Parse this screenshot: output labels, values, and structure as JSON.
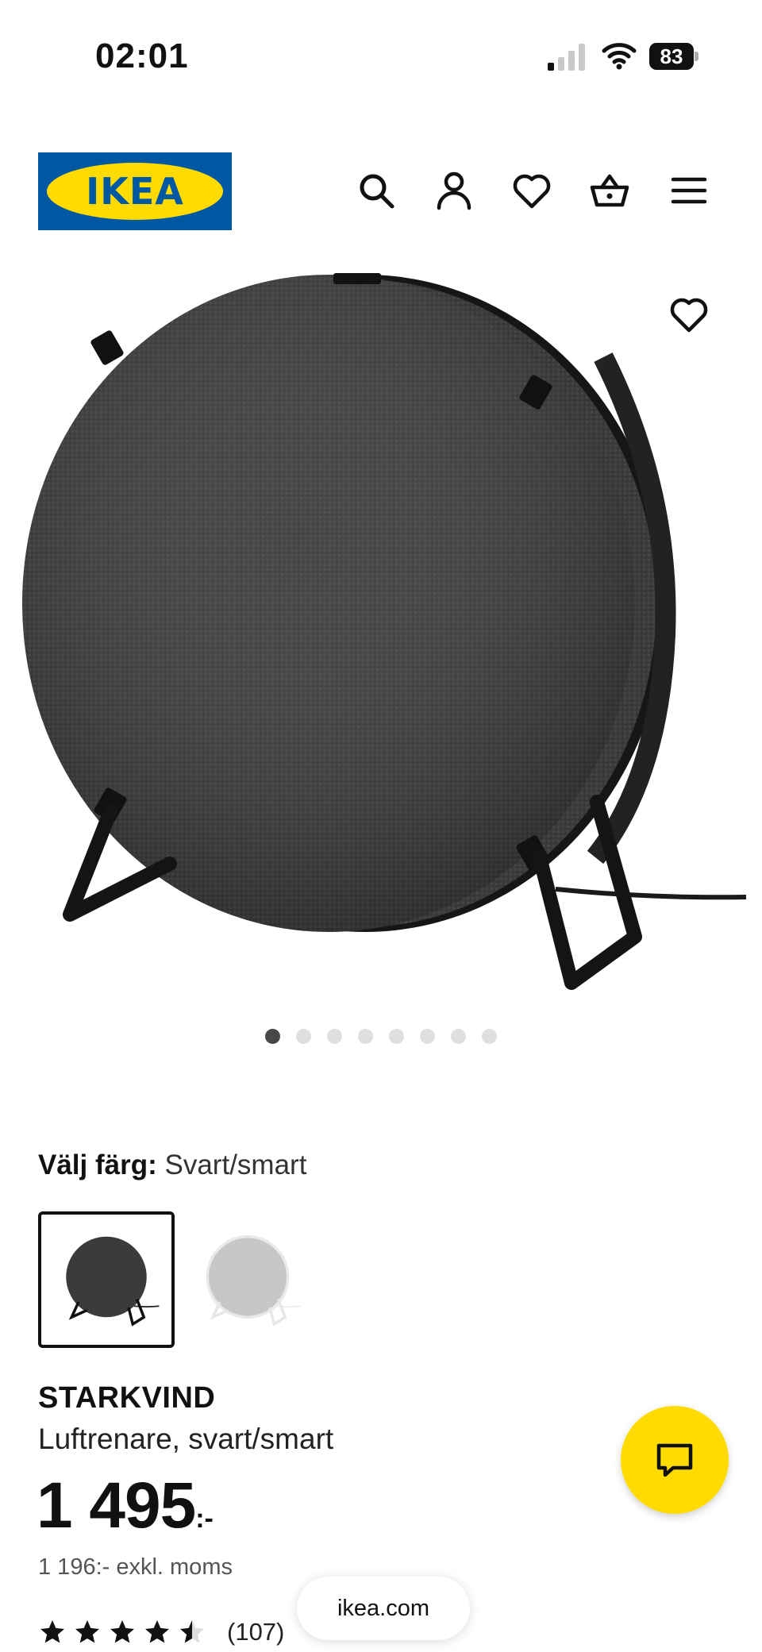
{
  "status_bar": {
    "time": "02:01",
    "battery": "83"
  },
  "header": {
    "logo_text": "IKEA",
    "icons": [
      "search-icon",
      "account-icon",
      "heart-icon",
      "basket-icon",
      "menu-icon"
    ]
  },
  "gallery": {
    "dot_count": 8,
    "active_index": 0
  },
  "color": {
    "label": "Välj färg:",
    "value": "Svart/smart",
    "options_count": 2,
    "selected_index": 0
  },
  "product": {
    "name": "STARKVIND",
    "description": "Luftrenare, svart/smart",
    "price_main": "1 495",
    "price_suffix": ":-",
    "price_exkl": "1 196:- exkl. moms",
    "rating": 4.5,
    "review_count": "(107)"
  },
  "browser": {
    "url": "ikea.com"
  },
  "colors": {
    "ikea_blue": "#0058a3",
    "ikea_yellow": "#ffdb00"
  }
}
